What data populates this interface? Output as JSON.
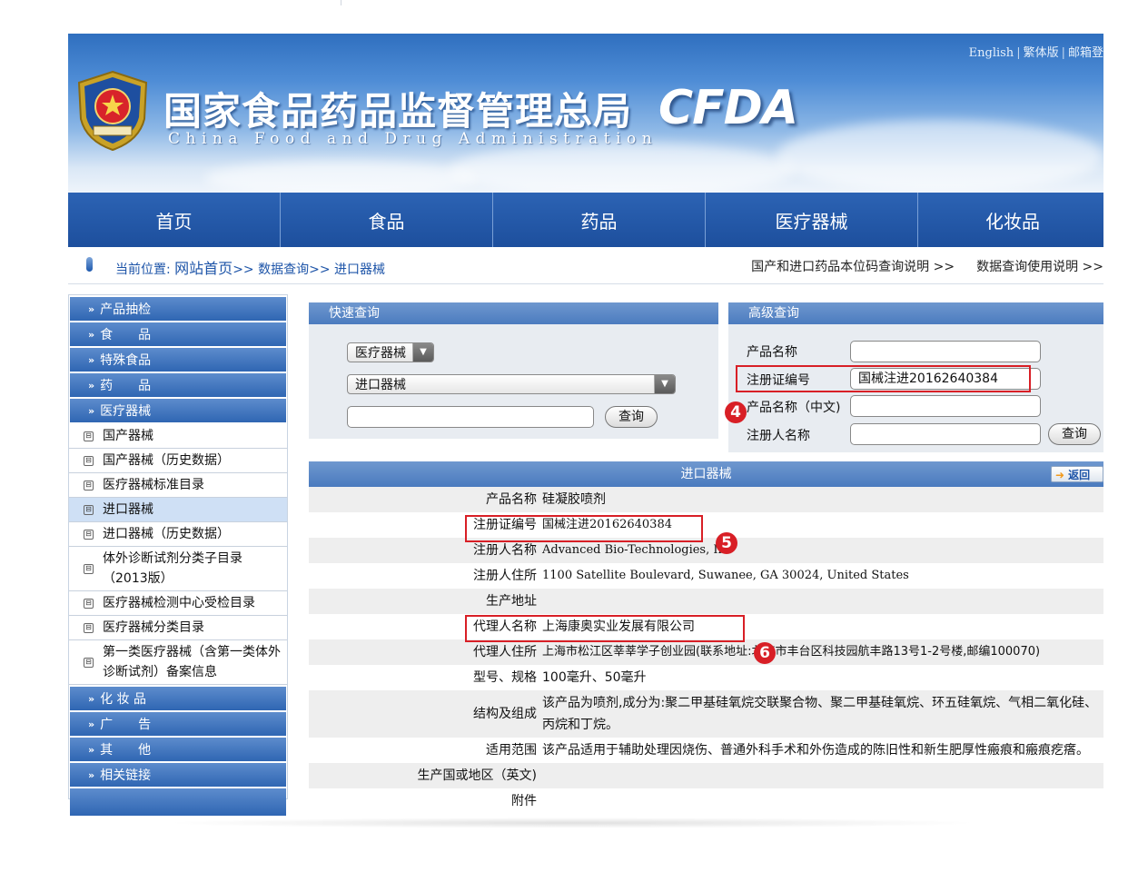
{
  "header": {
    "title_cn": "国家食品药品监督管理总局",
    "title_en": "China Food and Drug Administration",
    "logo_text": "CFDA",
    "lang_links": [
      "English",
      "繁体版",
      "邮箱登"
    ]
  },
  "nav": [
    "首页",
    "食品",
    "药品",
    "医疗器械",
    "化妆品"
  ],
  "breadcrumb": {
    "prefix": "当前位置:",
    "home": "网站首页",
    "rest": ">> 数据查询>> 进口器械",
    "right_links": [
      "国产和进口药品本位码查询说明 >>",
      "数据查询使用说明 >>"
    ]
  },
  "sidebar": {
    "sections": [
      "产品抽检",
      "食　　品",
      "特殊食品",
      "药　　品",
      "医疗器械"
    ],
    "sub_items": [
      "国产器械",
      "国产器械（历史数据）",
      "医疗器械标准目录",
      "进口器械",
      "进口器械（历史数据）",
      "体外诊断试剂分类子目录（2013版）",
      "医疗器械检测中心受检目录",
      "医疗器械分类目录",
      "第一类医疗器械（含第一类体外诊断试剂）备案信息"
    ],
    "sections_after": [
      "化 妆 品",
      "广　　告",
      "其　　他",
      "相关链接"
    ]
  },
  "quick_search": {
    "title": "快速查询",
    "category_select": "医疗器械",
    "subcategory_select": "进口器械",
    "query_button": "查询"
  },
  "advanced_search": {
    "title": "高级查询",
    "field1_label": "产品名称",
    "field2_label": "注册证编号",
    "field2_value": "国械注进20162640384",
    "field3_label": "产品名称（中文)",
    "field4_label": "注册人名称",
    "query_button": "查询"
  },
  "annotations": {
    "badge4": "4",
    "badge5": "5",
    "badge6": "6"
  },
  "result": {
    "title": "进口器械",
    "back_button": "返回",
    "rows": [
      {
        "k": "产品名称",
        "v": "硅凝胶喷剂"
      },
      {
        "k": "注册证编号",
        "v": "国械注进20162640384"
      },
      {
        "k": "注册人名称",
        "v": "Advanced Bio-Technologies, Inc"
      },
      {
        "k": "注册人住所",
        "v": "1100 Satellite Boulevard, Suwanee, GA 30024, United States"
      },
      {
        "k": "生产地址",
        "v": ""
      },
      {
        "k": "代理人名称",
        "v": "上海康奥实业发展有限公司"
      },
      {
        "k": "代理人住所",
        "v": "上海市松江区莘莘学子创业园(联系地址:北京市丰台区科技园航丰路13号1-2号楼,邮编100070)"
      },
      {
        "k": "型号、规格",
        "v": "100毫升、50毫升"
      },
      {
        "k": "结构及组成",
        "v": "该产品为喷剂,成分为:聚二甲基硅氧烷交联聚合物、聚二甲基硅氧烷、环五硅氧烷、气相二氧化硅、丙烷和丁烷。"
      },
      {
        "k": "适用范围",
        "v": "该产品适用于辅助处理因烧伤、普通外科手术和外伤造成的陈旧性和新生肥厚性瘢痕和瘢痕疙瘩。"
      },
      {
        "k": "生产国或地区（英文)",
        "v": ""
      },
      {
        "k": "附件",
        "v": ""
      }
    ]
  },
  "colors": {
    "nav_blue": "#1d4f9d",
    "highlight_red": "#d81f26",
    "panel_blue": "#4b7bbf"
  }
}
